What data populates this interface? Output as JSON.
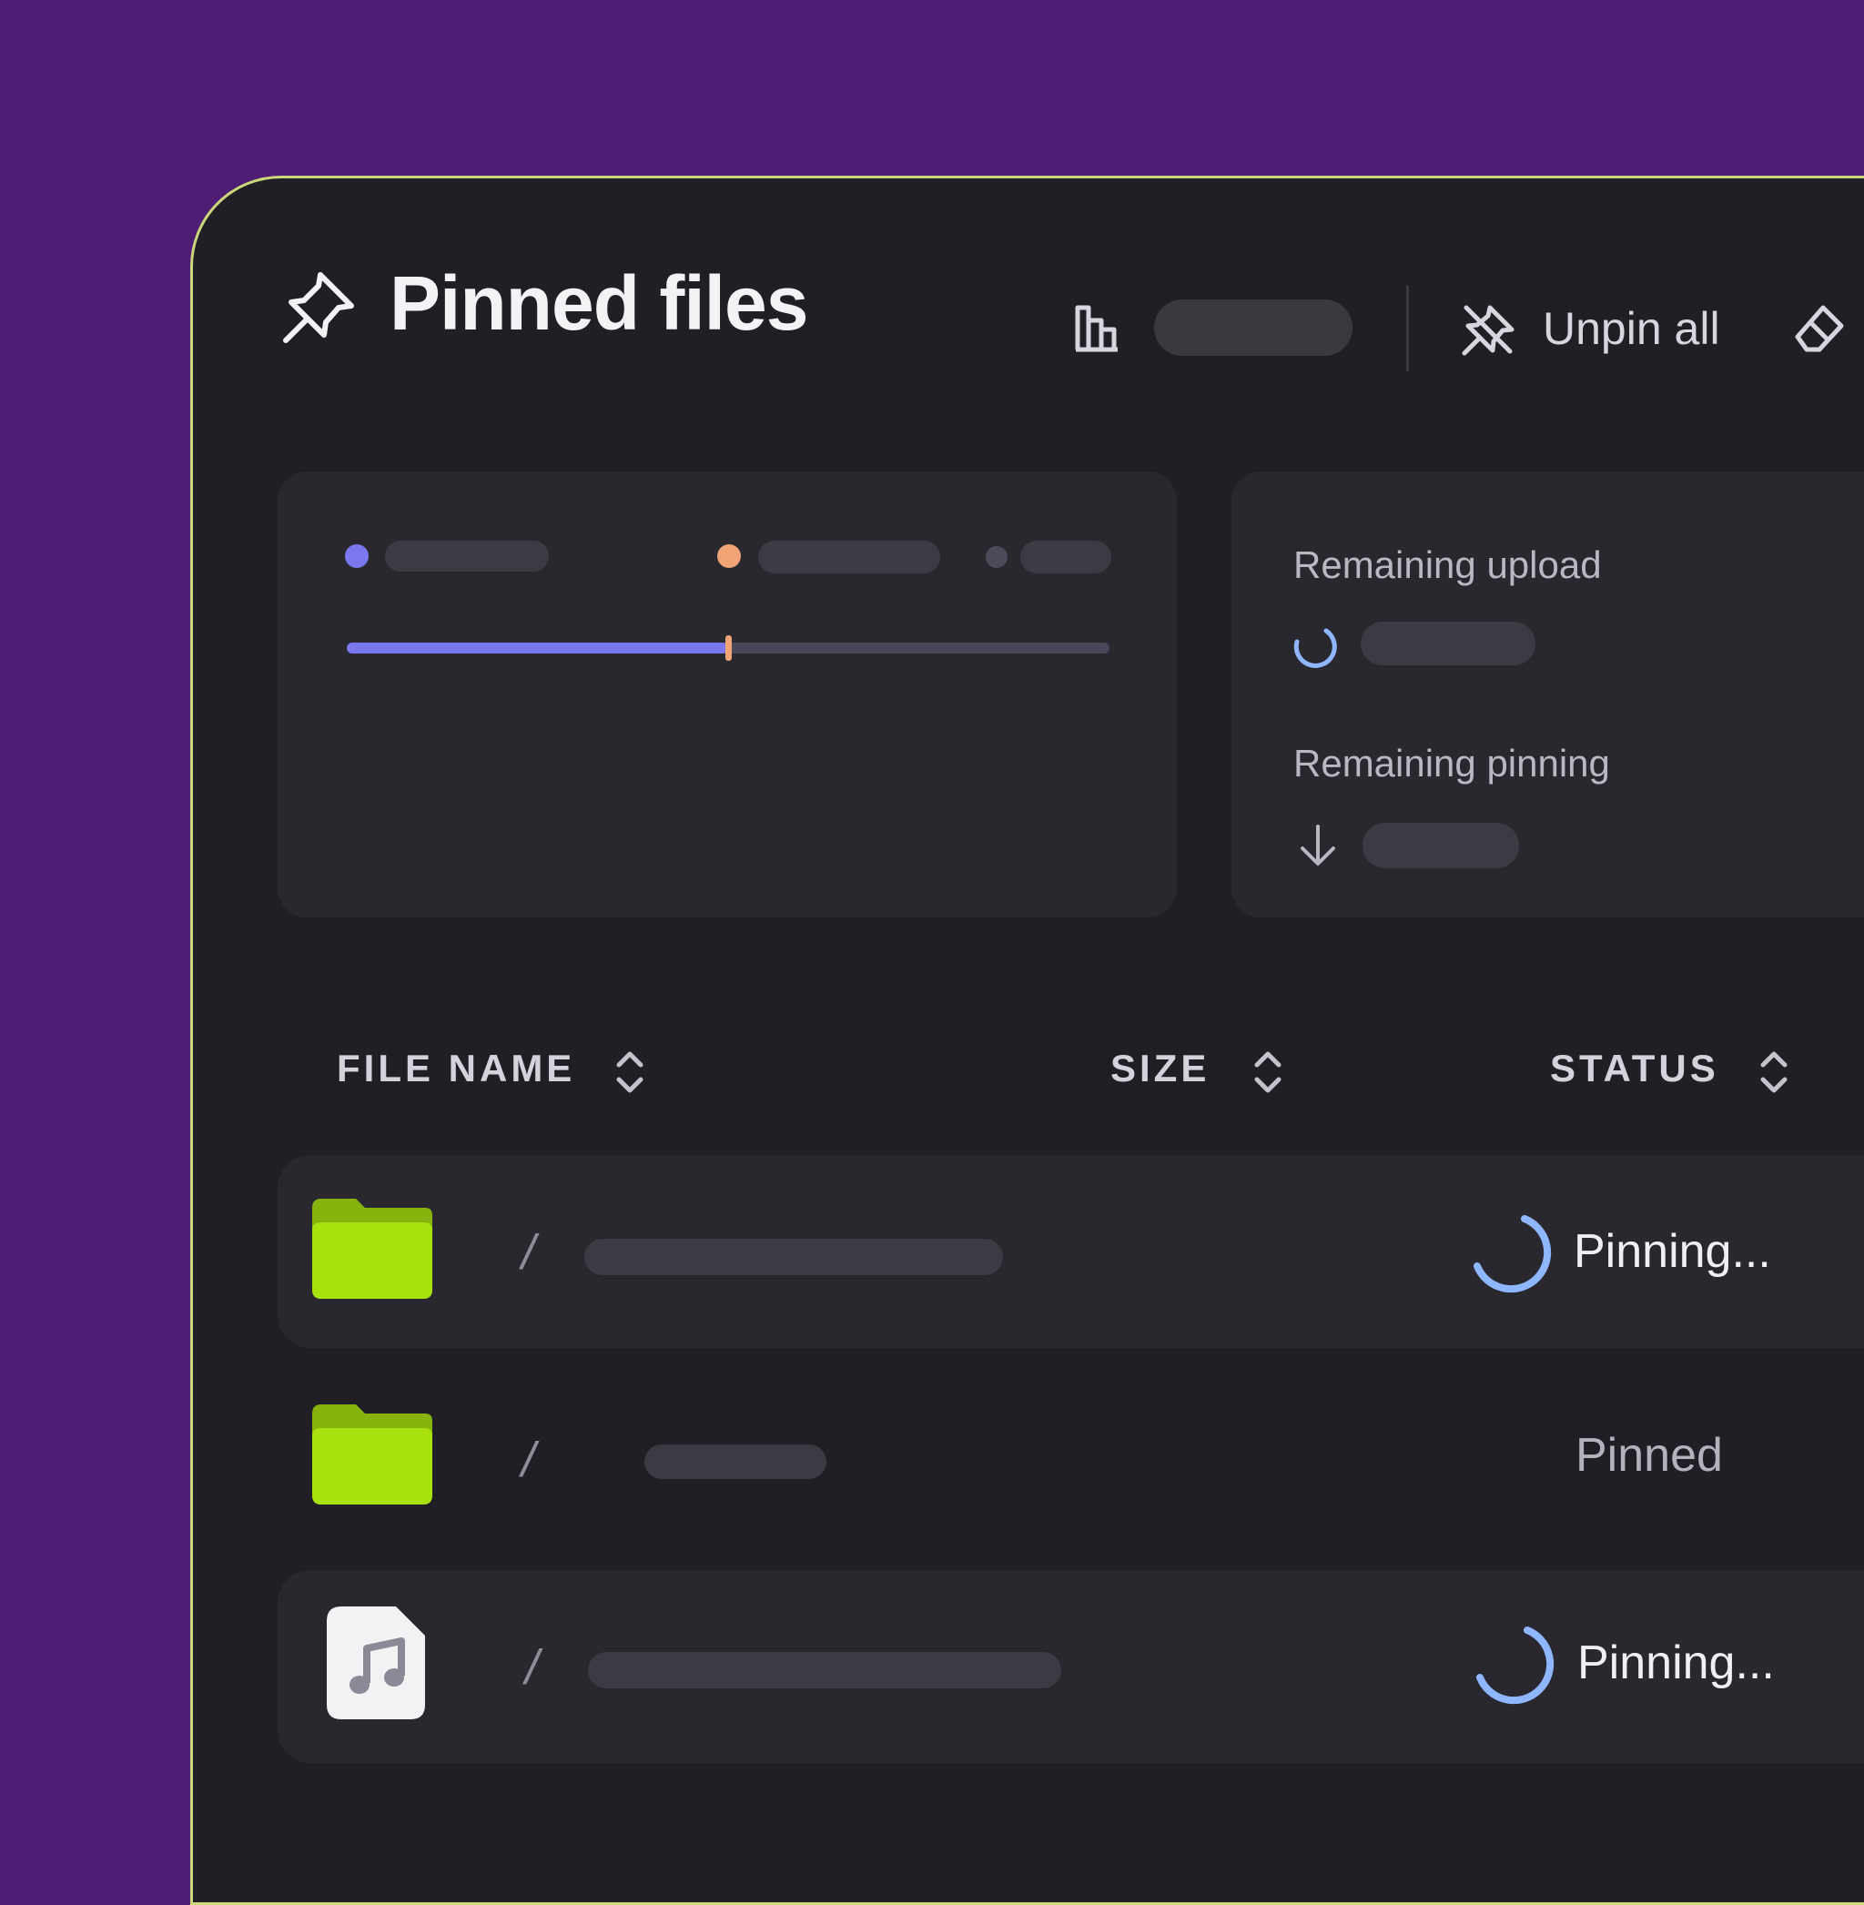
{
  "header": {
    "title": "Pinned files",
    "unpin_all_label": "Unpin all"
  },
  "progress": {
    "fill_fraction": 0.5,
    "accent_color": "#7b78ef",
    "marker_color": "#f0a374",
    "legend_colors": [
      "#7b78ef",
      "#f0a374",
      "#4d4b5a"
    ]
  },
  "remaining": {
    "upload_label": "Remaining upload",
    "pinning_label": "Remaining pinning"
  },
  "table": {
    "columns": {
      "file_name": "FILE NAME",
      "size": "SIZE",
      "status": "STATUS"
    },
    "rows": [
      {
        "icon": "folder-icon",
        "separator": "/",
        "status": "Pinning..."
      },
      {
        "icon": "folder-icon",
        "separator": "/",
        "status": "Pinned"
      },
      {
        "icon": "music-file-icon",
        "separator": "/",
        "status": "Pinning..."
      }
    ]
  },
  "colors": {
    "background": "#4e1d74",
    "panel": "#201f25",
    "border": "#ccd67a",
    "folder": "#a9e10f",
    "spinner": "#8fb7ff"
  }
}
